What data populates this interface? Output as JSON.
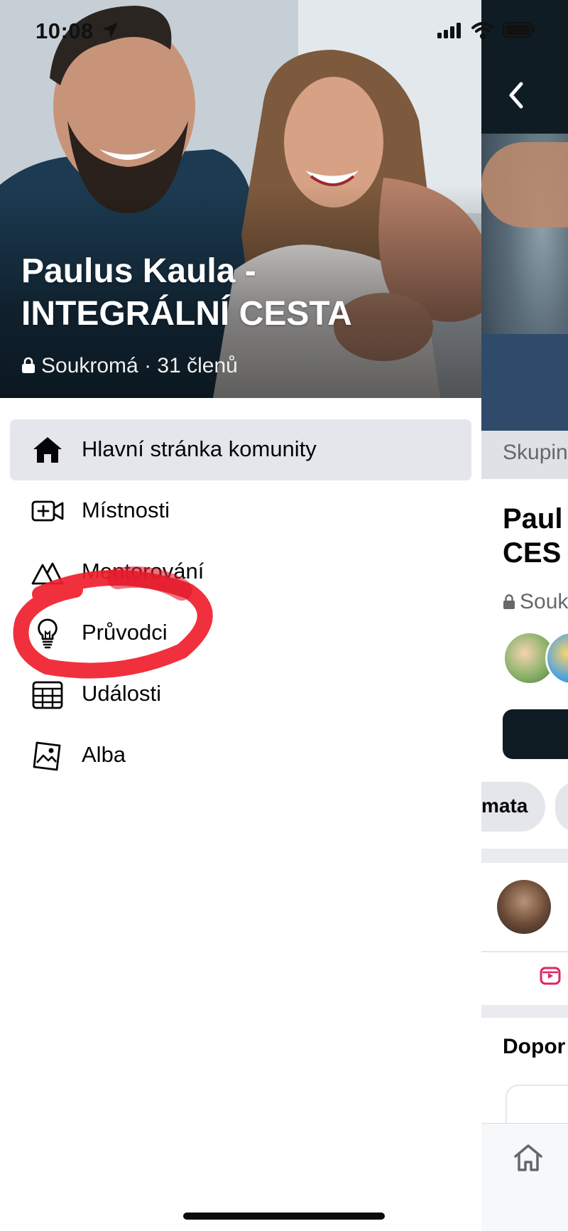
{
  "status_bar": {
    "time": "10:08",
    "icons": [
      "location-arrow-icon",
      "signal-icon",
      "wifi-icon",
      "battery-icon"
    ]
  },
  "group": {
    "title": "Paulus Kaula - INTEGRÁLNÍ CESTA",
    "privacy": "Soukromá",
    "separator": " · ",
    "members": "31 členů"
  },
  "menu": {
    "items": [
      {
        "label": "Hlavní stránka komunity",
        "icon": "home-icon",
        "active": true
      },
      {
        "label": "Místnosti",
        "icon": "video-plus-icon",
        "active": false
      },
      {
        "label": "Mentorování",
        "icon": "mountains-icon",
        "active": false
      },
      {
        "label": "Průvodci",
        "icon": "lightbulb-icon",
        "active": false,
        "highlighted": true
      },
      {
        "label": "Události",
        "icon": "calendar-icon",
        "active": false
      },
      {
        "label": "Alba",
        "icon": "photo-album-icon",
        "active": false
      }
    ]
  },
  "background_page": {
    "tab_label": "Skupin",
    "title_line1": "Paul",
    "title_line2": "CES",
    "privacy": "Souk",
    "chip_label": "mata",
    "suggest_title": "Dopor"
  },
  "colors": {
    "highlight_annotation": "#f01e2c",
    "active_item_bg": "#e4e6eb",
    "dark_bar": "#0f1c24"
  }
}
